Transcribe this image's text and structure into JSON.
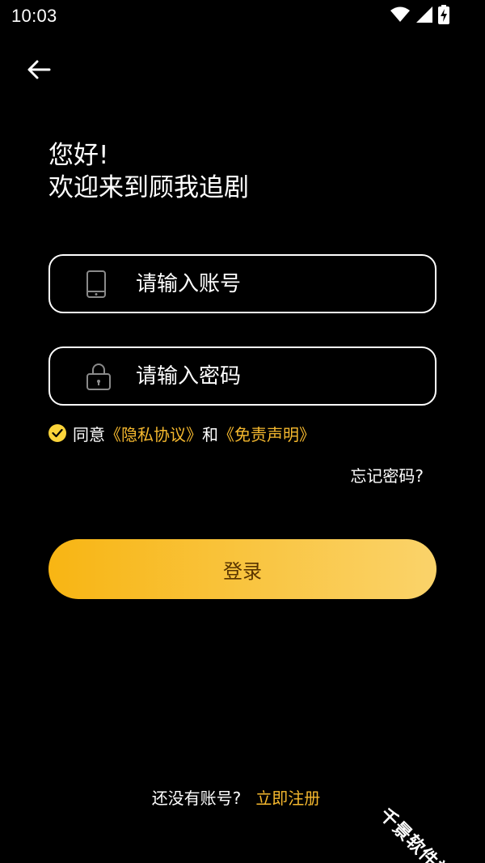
{
  "status_bar": {
    "time": "10:03",
    "icons": [
      "wifi-icon",
      "cellular-signal-icon",
      "battery-charging-icon"
    ]
  },
  "header": {
    "back_icon": "back-arrow-icon"
  },
  "greeting": {
    "line1": "您好!",
    "line2": "欢迎来到顾我追剧"
  },
  "form": {
    "account": {
      "icon": "phone-icon",
      "placeholder": "请输入账号",
      "value": ""
    },
    "password": {
      "icon": "lock-icon",
      "placeholder": "请输入密码",
      "value": ""
    },
    "agreement": {
      "checked": true,
      "prefix": "同意",
      "privacy_link": "《隐私协议》",
      "conjunction": "和",
      "disclaimer_link": "《免责声明》"
    },
    "forgot_password": "忘记密码?",
    "login_label": "登录"
  },
  "footer": {
    "no_account": "还没有账号?",
    "register_link": "立即注册"
  },
  "watermark": "千景软件站",
  "colors": {
    "background": "#000000",
    "accent": "#f5b82e",
    "check": "#fbd43a",
    "button_gradient_start": "#f8b513",
    "button_gradient_end": "#fad36a",
    "button_text": "#5a3500"
  }
}
